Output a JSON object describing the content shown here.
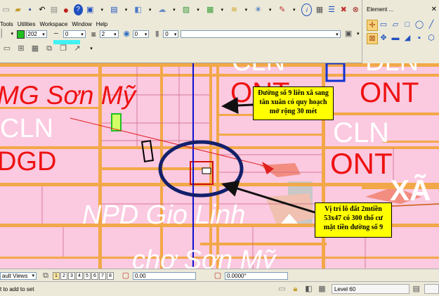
{
  "menu": [
    "Tools",
    "Utilities",
    "Workspace",
    "Window",
    "Help"
  ],
  "attributes": {
    "color_value": "202",
    "style_value": "0",
    "weight_value": "2",
    "transparency_value": "0",
    "priority_value": "0"
  },
  "element_panel": {
    "title": "Element ..."
  },
  "map": {
    "labels": {
      "mg_son_my": "MG Sơn Mỹ",
      "cln_left": "CLN",
      "dgd_left": "DGD",
      "cln_top": "CLN",
      "ont_top": "ONT",
      "dln_top": "DLN",
      "ont_right": "ONT",
      "cln_mid": "CLN",
      "ont_mid": "ONT",
      "xa_right": "XÃ",
      "npd": "NPD Gio Linh",
      "cho": "chợ Sơn Mỹ"
    },
    "callouts": {
      "road": "Đường số 9 liên xã sang tân xuân có quy hoạch mở rộng 30 mét",
      "lot": "Vị trí lô đất 2mtiền 53x47 có 300 thổ cư mặt tiền đường số 9"
    },
    "colors": {
      "parcel_fill": "#fbc9e0",
      "road": "#f2a848",
      "road_outline": "#c85b10",
      "label_red": "#ee1111",
      "ellipse": "#13206b",
      "vertical_line": "#1010d0"
    }
  },
  "status": {
    "view_combo": "ault Views",
    "view_buttons": [
      "1",
      "2",
      "3",
      "4",
      "5",
      "6",
      "7",
      "8"
    ],
    "x_value": "0.00",
    "angle_value": "0.0000°"
  },
  "bottom": {
    "prompt": "t to add to set",
    "level": "Level 60"
  }
}
